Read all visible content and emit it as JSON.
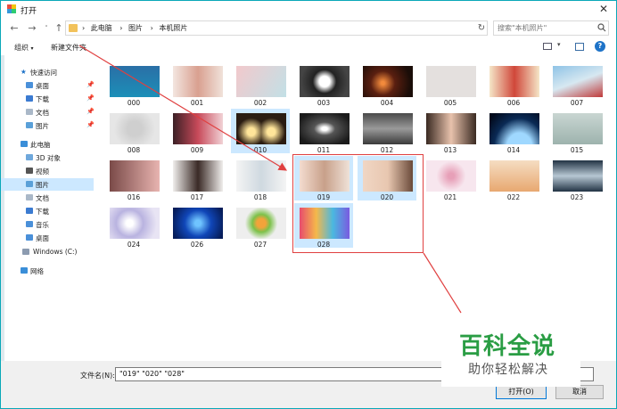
{
  "window": {
    "title": "打开"
  },
  "address": {
    "path": [
      "此电脑",
      "图片",
      "本机照片"
    ],
    "search_placeholder": "搜索\"本机照片\""
  },
  "toolbar": {
    "organize": "组织",
    "new_folder": "新建文件夹"
  },
  "sidebar": {
    "quick_access": "快速访问",
    "quick_items": [
      "桌面",
      "下载",
      "文档",
      "图片"
    ],
    "this_pc": "此电脑",
    "pc_items": [
      "3D 对象",
      "视频",
      "图片",
      "文档",
      "下载",
      "音乐",
      "桌面",
      "Windows (C:)"
    ],
    "network": "网络"
  },
  "files": [
    {
      "name": "000"
    },
    {
      "name": "001"
    },
    {
      "name": "002"
    },
    {
      "name": "003"
    },
    {
      "name": "004"
    },
    {
      "name": "005"
    },
    {
      "name": "006"
    },
    {
      "name": "007"
    },
    {
      "name": "008"
    },
    {
      "name": "009"
    },
    {
      "name": "010"
    },
    {
      "name": "011"
    },
    {
      "name": "012"
    },
    {
      "name": "013"
    },
    {
      "name": "014"
    },
    {
      "name": "015"
    },
    {
      "name": "016"
    },
    {
      "name": "017"
    },
    {
      "name": "018"
    },
    {
      "name": "019"
    },
    {
      "name": "020"
    },
    {
      "name": "021"
    },
    {
      "name": "022"
    },
    {
      "name": "023"
    },
    {
      "name": "024"
    },
    {
      "name": "026"
    },
    {
      "name": "027"
    },
    {
      "name": "028"
    }
  ],
  "bottom": {
    "filename_label": "文件名(N):",
    "filename_value": "\"019\" \"020\" \"028\"",
    "open_button": "打开(O)",
    "cancel_button": "取消"
  },
  "watermark": {
    "main": "百科全说",
    "sub": "助你轻松解决"
  },
  "colors": {
    "accent": "#0078d7",
    "selection": "#cce8ff",
    "highlight_box": "#e04040",
    "watermark": "#2a9d44"
  }
}
